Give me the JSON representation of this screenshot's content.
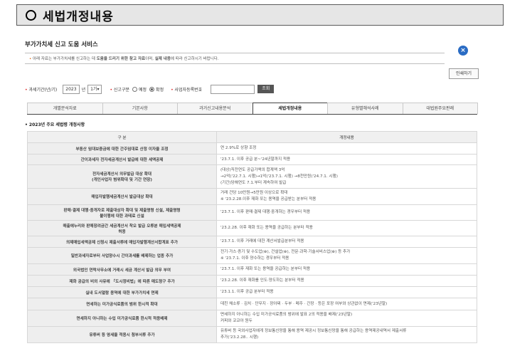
{
  "header": {
    "title": "세법개정내용"
  },
  "service_title": "부가가치세 신고 도움 서비스",
  "notice": {
    "bullet": "•",
    "text_pre": "아래 자료는 부가가치세를 신고하는 데 ",
    "text_bold1": "도움을 드리기 위한 참고 자료",
    "text_mid": "이며, ",
    "text_bold2": "실제 내용",
    "text_post": "에 따라 신고하시기 바랍니다."
  },
  "close_label": "×",
  "print_label": "인쇄하기",
  "filter": {
    "period_label": "과세기간(년/기)",
    "year": "2023",
    "year_unit": "년",
    "term": "1기",
    "term_arrow": "▾",
    "report_type_label": "신고구분",
    "opt_preliminary": "예정",
    "opt_final": "확정",
    "bizno_label": "사업자등록번호",
    "query_label": "조회"
  },
  "tabs": [
    {
      "label": "개별분석자료"
    },
    {
      "label": "기본사항"
    },
    {
      "label": "과거신고내용분석"
    },
    {
      "label": "세법개정내용"
    },
    {
      "label": "유형별해석사례"
    },
    {
      "label": "대법원주요판례"
    }
  ],
  "subtitle": "• 2023년 주요 세법령 개정사항",
  "table": {
    "headers": [
      "구 분",
      "개정내용"
    ],
    "rows": [
      {
        "item": "부동산 임대보증금에 대한 간주임대료 산정 이자율 조정",
        "content": "연 2.9%로 상향 조정"
      },
      {
        "item": "간이과세자 전자세금계산서 발급에 대한 세액공제",
        "content": "'23.7.1. 이후 공급 분~'24년말까지 적용"
      },
      {
        "item": "전자세금계산서 의무발급 대상 확대\n(개인사업자 범위확대 및 기간 연장)",
        "content": "(대상)직전연도 공급가액의 합계액 3억\n→2억('22.7.1. 시행)→1억('23.7.1. 시행) →8천만원('24.7.1. 시행)\n(기간)당해연도 7.1.부터 계속하여 발급"
      },
      {
        "item": "매입자발행세금계산서 발급대상 확대",
        "content": "거래 건당 10만원→5만원 이상으로 확대\n※ '23.2.28.이후 재화 또는 용역을 공급받는 분부터 적용"
      },
      {
        "item": "판매·결제 대행·중개자로 제출대상자 확대 및 제출명령 신설, 제출명령\n불이행에 대한 과태료 신설",
        "content": "'23.7.1. 이후 판매·결제 대행·중개하는 경우부터 적용"
      },
      {
        "item": "매출에누리와 판매장려금간 세금계산서 착오 발급 오류분 매입세액공제\n허용",
        "content": "'23.2.28. 이후 재화 또는 용역을 공급하는 분부터 적용"
      },
      {
        "item": "의제매입세액공제 신청시 제출서류에 매입자발행계산서합계표 추가",
        "content": "'23.7.1. 이후 거래에 대한 계산서발급분부터 적용"
      },
      {
        "item": "일반과세자로부터 사업양수시 간이과세를 배제하는 업종 추가",
        "content": "전기·가스·증기 및 수도업(⊕), 건설업(⊕), 전문·과학·기술서비스업(⊕) 등 추가\n※ '23.7.1. 이후 양수하는 경우부터 적용"
      },
      {
        "item": "외국법인 연락사무소에 거래시 세금 계산서 발급 의무 부여",
        "content": "'23.7.1. 이후 재화 또는 용역을 공급하는 분부터 적용"
      },
      {
        "item": "재화 공급의 비외 사유에 「도시정비법」에 따른 매도청구 추가",
        "content": "'23.2.28. 이후 재화를 인도·양도하는 분부터 적용"
      },
      {
        "item": "실내 도서열람 용역에 대한 부가가치세 면제",
        "content": "'23.1.1. 이후 공급 분부터 적용"
      },
      {
        "item": "면세하는 미가공식료품의 범위 한시적 확대",
        "content": "데친 채소류 · 김치 · 단무지 · 장아찌 · 두부 · 메주 · 간장 · 등은 포장 여부와 상관없이 면제('23년말)"
      },
      {
        "item": "면세하지 아니하는 수입 미가공식료품 한시적 적용배제",
        "content": "면세하지 아니하는 수입 미가공식료품의 범위에 발표 2의 적용을 배제('23년말)\n커피와 코코아 원두"
      },
      {
        "item": "유튜버 등 영세율 적용시 첨부서류 추가",
        "content": "유튜버 등 국외사업자에게 정보통신망을 통해 용역 제공시 정보통신망을 통해 공급하는 용역제공내역서 제출서류\n추가('23.2.28.. 시행)"
      }
    ]
  }
}
